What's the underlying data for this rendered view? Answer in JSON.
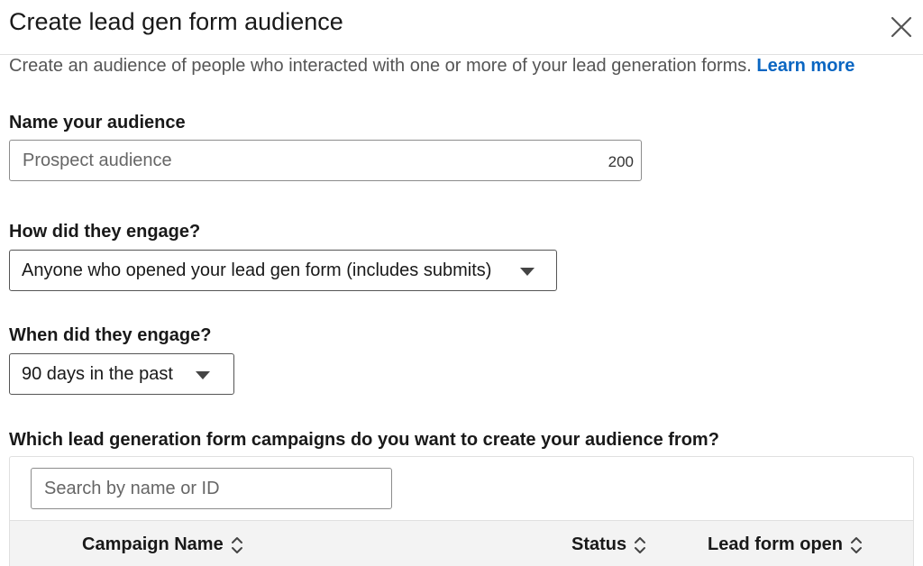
{
  "modal": {
    "title": "Create lead gen form audience",
    "close_label": "Close"
  },
  "intro": {
    "text": "Create an audience of people who interacted with one or more of your lead generation forms.",
    "link": "Learn more"
  },
  "name_field": {
    "label": "Name your audience",
    "placeholder": "Prospect audience",
    "value": "",
    "char_limit": "200"
  },
  "engagement_type": {
    "label": "How did they engage?",
    "selected": "Anyone who opened your lead gen form (includes submits)"
  },
  "engagement_window": {
    "label": "When did they engage?",
    "selected": "90 days in the past"
  },
  "campaigns": {
    "label": "Which lead generation form campaigns do you want to create your audience from?",
    "search_placeholder": "Search by name or ID",
    "columns": [
      {
        "label": "Campaign Name",
        "sortable": true
      },
      {
        "label": "Status",
        "sortable": true
      },
      {
        "label": "Lead form open",
        "sortable": true
      }
    ]
  },
  "icons": {
    "close": "close-icon",
    "caret": "caret-down-icon",
    "sort": "sort-icon"
  },
  "colors": {
    "link": "#0a66c2",
    "text": "#191919",
    "table_header_bg": "#f3f3f3"
  }
}
